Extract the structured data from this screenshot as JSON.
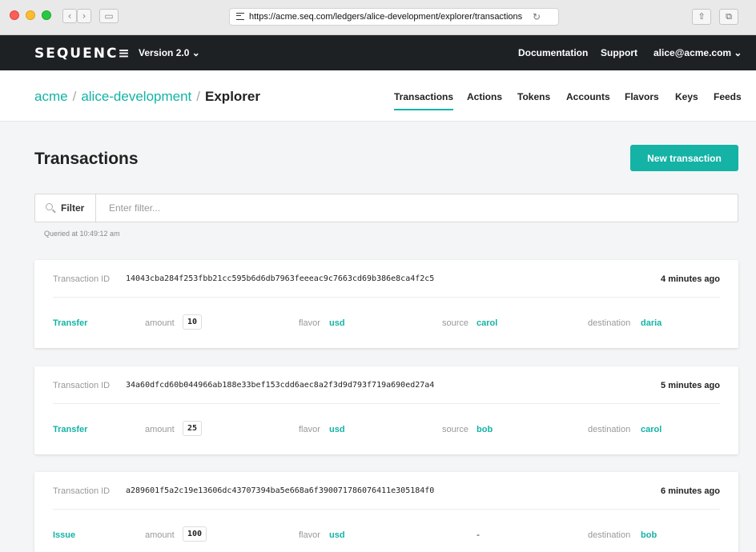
{
  "browser": {
    "url": "https://acme.seq.com/ledgers/alice-development/explorer/transactions",
    "back_icon": "‹",
    "forward_icon": "›",
    "reload_icon": "↻",
    "share_icon": "⇧",
    "tabs_icon": "⧉"
  },
  "header": {
    "logo": "SEQUENC≡",
    "version": "Version 2.0 ⌄",
    "documentation": "Documentation",
    "support": "Support",
    "user": "alice@acme.com ⌄"
  },
  "breadcrumb": {
    "org": "acme",
    "sep1": "/",
    "ledger": "alice-development",
    "sep2": "/",
    "current": "Explorer"
  },
  "tabs": [
    "Transactions",
    "Actions",
    "Tokens",
    "Accounts",
    "Flavors",
    "Keys",
    "Feeds"
  ],
  "active_tab": "Transactions",
  "page": {
    "title": "Transactions",
    "new_button": "New transaction",
    "filter_label": "Filter",
    "filter_placeholder": "Enter filter...",
    "filter_value": "",
    "queried": "Queried at 10:49:12 am"
  },
  "labels": {
    "transaction_id": "Transaction ID",
    "amount": "amount",
    "flavor": "flavor",
    "source": "source",
    "destination": "destination"
  },
  "transactions": [
    {
      "id": "14043cba284f253fbb21cc595b6d6db7963feeeac9c7663cd69b386e8ca4f2c5",
      "time": "4 minutes ago",
      "action": "Transfer",
      "amount": "10",
      "flavor": "usd",
      "source": "carol",
      "destination": "daria"
    },
    {
      "id": "34a60dfcd60b044966ab188e33bef153cdd6aec8a2f3d9d793f719a690ed27a4",
      "time": "5 minutes ago",
      "action": "Transfer",
      "amount": "25",
      "flavor": "usd",
      "source": "bob",
      "destination": "carol"
    },
    {
      "id": "a289601f5a2c19e13606dc43707394ba5e668a6f390071786076411e305184f0",
      "time": "6 minutes ago",
      "action": "Issue",
      "amount": "100",
      "flavor": "usd",
      "source": "-",
      "destination": "bob"
    }
  ],
  "colors": {
    "accent": "#14b3a5",
    "header_bg": "#1e2124"
  }
}
